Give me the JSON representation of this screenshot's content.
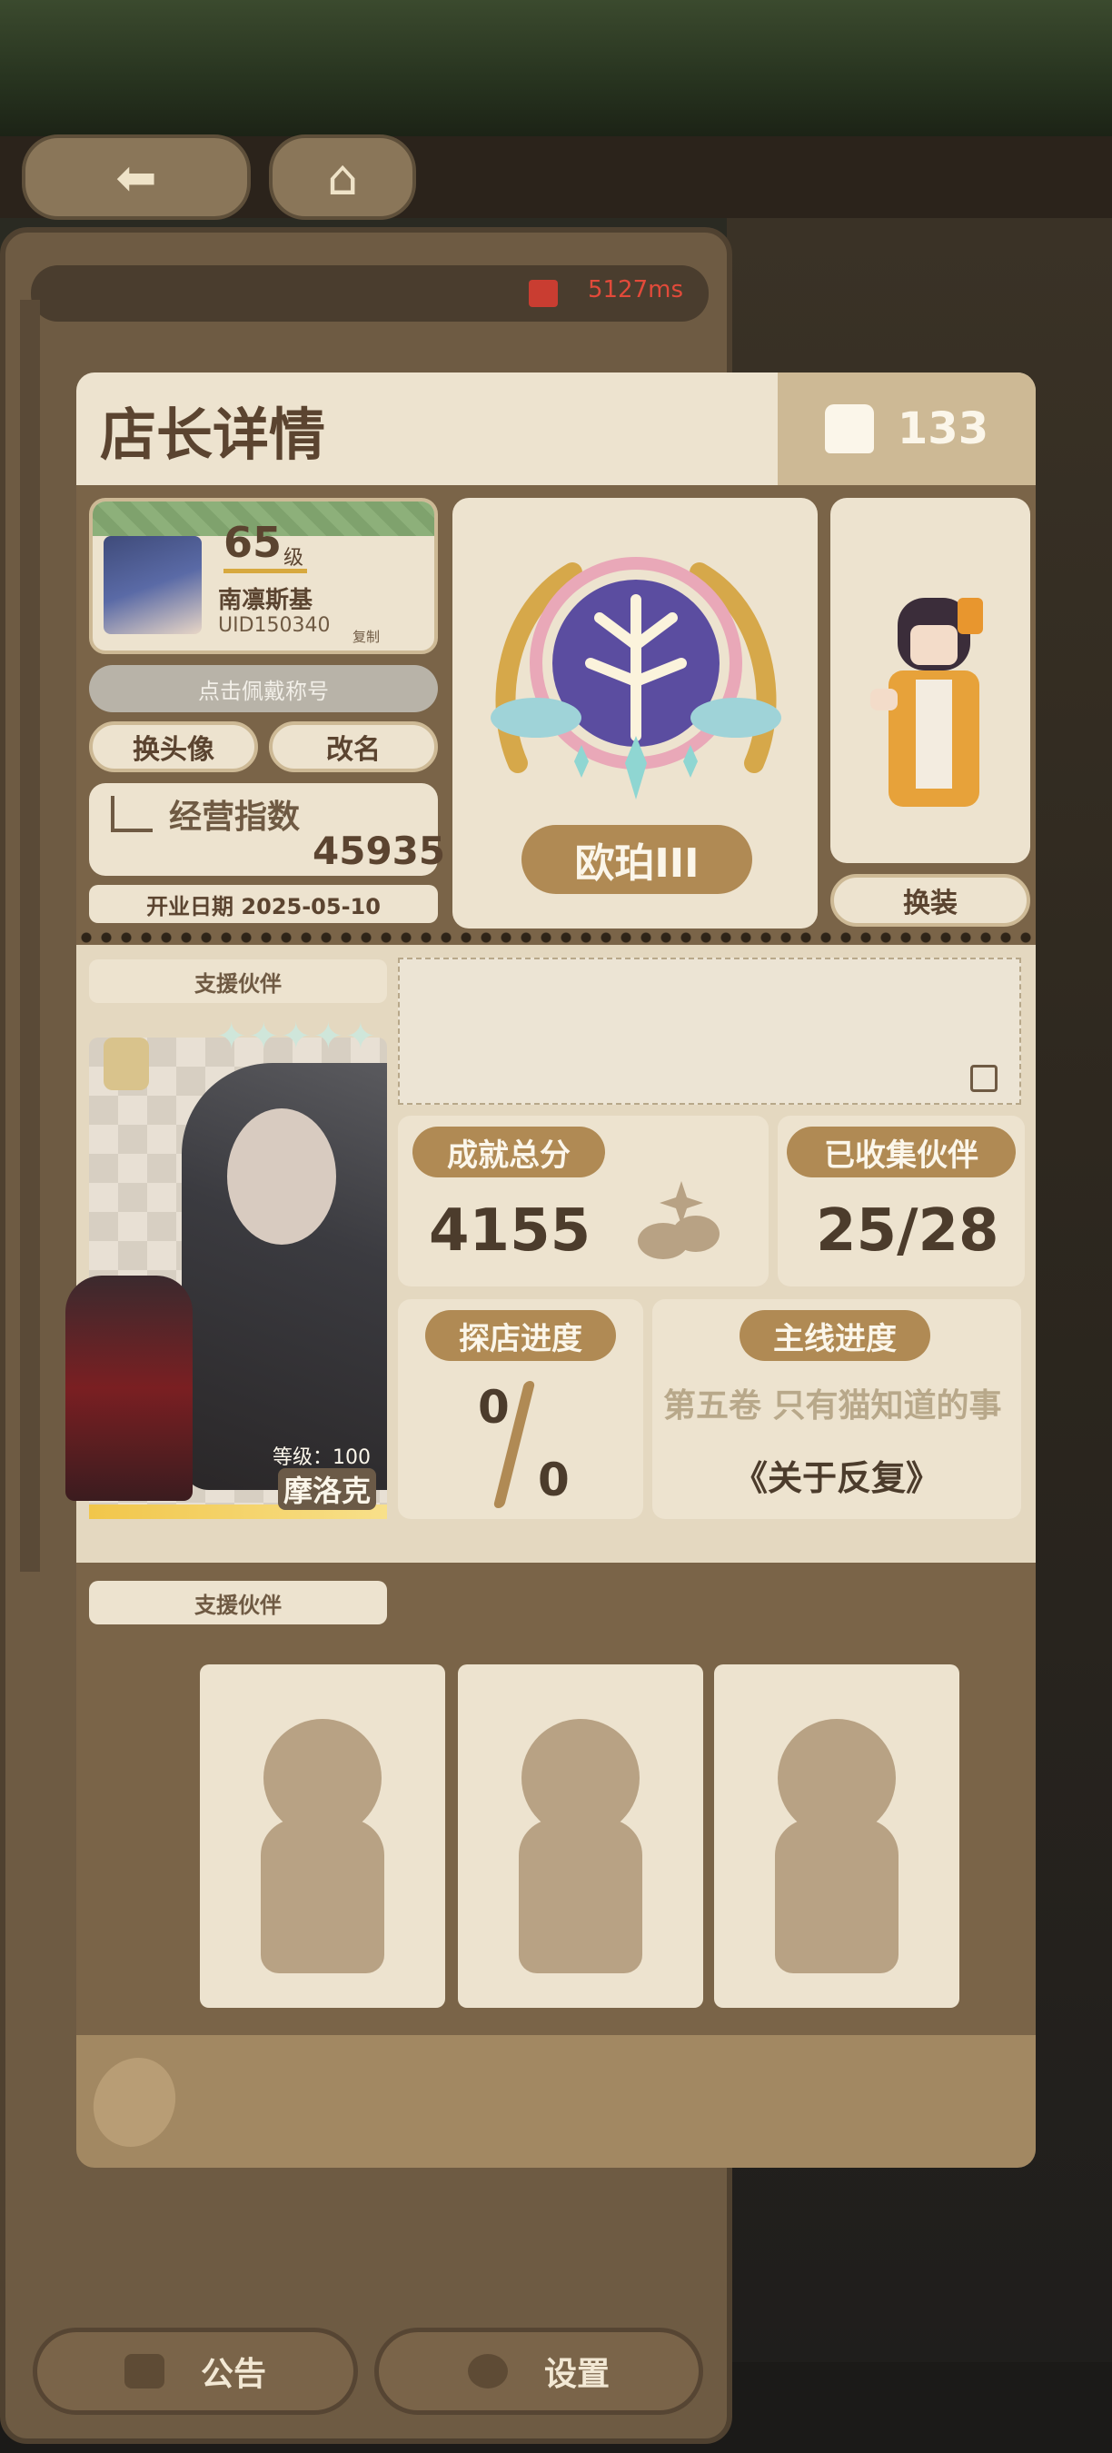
{
  "network": {
    "ping": "5127ms"
  },
  "header": {
    "title": "店长详情",
    "likes": "133"
  },
  "profile": {
    "level": "65",
    "level_unit": "级",
    "name": "南凛斯基",
    "uid": "UID150340",
    "copy_label": "复制",
    "equip_title_hint": "点击佩戴称号",
    "change_avatar": "换头像",
    "rename": "改名",
    "business_index_label": "经营指数",
    "business_index_value": "45935",
    "open_date": "开业日期 2025-05-10"
  },
  "title_badge": {
    "name": "欧珀III"
  },
  "character": {
    "dress_button": "换装"
  },
  "support": {
    "section_label": "支援伙伴",
    "partner": {
      "level": "等级：100",
      "name": "摩洛克",
      "stars": "✦✦✦✦✦"
    }
  },
  "stats": {
    "achievement_label": "成就总分",
    "achievement_value": "4155",
    "collected_label": "已收集伙伴",
    "collected_value": "25/28",
    "shop_label": "探店进度",
    "shop_current": "0",
    "shop_total": "0",
    "main_label": "主线进度",
    "main_chapter": "第五卷 只有猫知道的事",
    "main_title": "《关于反复》"
  },
  "support2": {
    "section_label": "支援伙伴"
  },
  "bottom_nav": {
    "notice": "公告",
    "settings": "设置"
  },
  "colors": {
    "panel": "#ede3cf",
    "accent": "#b08a54",
    "frame": "#7a6448"
  }
}
